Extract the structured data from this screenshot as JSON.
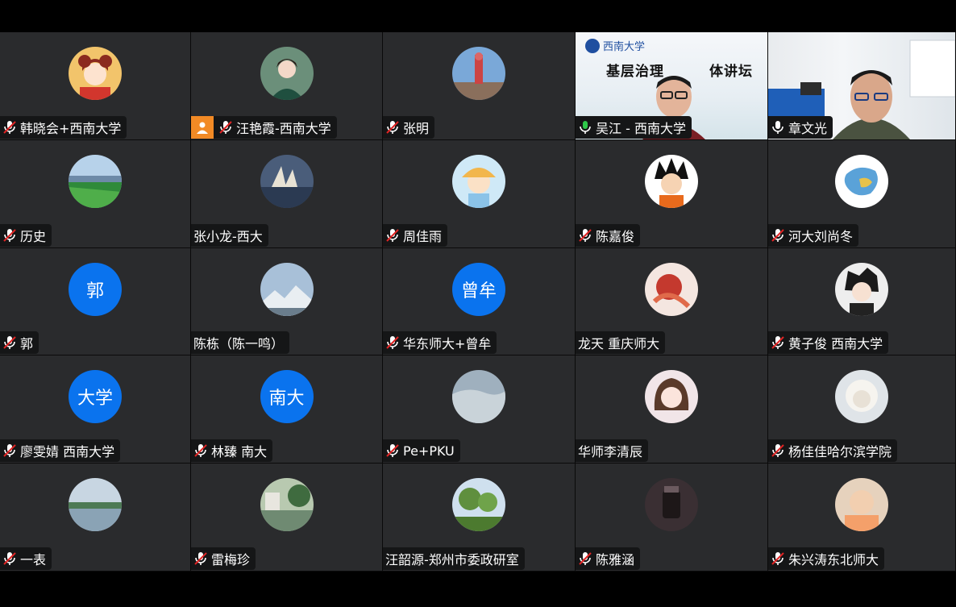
{
  "participants": [
    {
      "name": "韩晓会+西南大学",
      "muted": true,
      "avatar": "illustration-girl"
    },
    {
      "name": "汪艳霞-西南大学",
      "muted": true,
      "avatar": "portrait-woman",
      "host_badge": true
    },
    {
      "name": "张明",
      "muted": true,
      "avatar": "tower-photo"
    },
    {
      "name": "吴江 - 西南大学",
      "muted": false,
      "avatar": "video-slide",
      "speaking": true
    },
    {
      "name": "章文光",
      "muted": false,
      "avatar": "video-room"
    },
    {
      "name": "历史",
      "muted": true,
      "avatar": "lake-photo"
    },
    {
      "name": "张小龙-西大",
      "muted": false,
      "avatar": "opera-house"
    },
    {
      "name": "周佳雨",
      "muted": true,
      "avatar": "cartoon-boy"
    },
    {
      "name": "陈嘉俊",
      "muted": true,
      "avatar": "goku"
    },
    {
      "name": "河大刘尚冬",
      "muted": true,
      "avatar": "china-map"
    },
    {
      "name": "郭",
      "muted": true,
      "avatar": "letter",
      "letter": "郭"
    },
    {
      "name": "陈栋（陈一鸣）",
      "muted": false,
      "avatar": "mountain"
    },
    {
      "name": "华东师大+曾牟",
      "muted": true,
      "avatar": "letter",
      "letter": "曾牟"
    },
    {
      "name": "龙天 重庆师大",
      "muted": false,
      "avatar": "red-art"
    },
    {
      "name": "黄子俊 西南大学",
      "muted": true,
      "avatar": "anime-boy"
    },
    {
      "name": "廖雯婧 西南大学",
      "muted": true,
      "avatar": "letter",
      "letter": "大学"
    },
    {
      "name": "林臻 南大",
      "muted": true,
      "avatar": "letter",
      "letter": "南大"
    },
    {
      "name": "Pe+PKU",
      "muted": true,
      "avatar": "sky"
    },
    {
      "name": "华师李清辰",
      "muted": false,
      "avatar": "anime-girl"
    },
    {
      "name": "杨佳佳哈尔滨学院",
      "muted": true,
      "avatar": "white-lion"
    },
    {
      "name": "一表",
      "muted": true,
      "avatar": "river"
    },
    {
      "name": "雷梅珍",
      "muted": true,
      "avatar": "canal"
    },
    {
      "name": "汪韶源-郑州市委政研室",
      "muted": false,
      "avatar": "trees"
    },
    {
      "name": "陈雅涵",
      "muted": true,
      "avatar": "dark-object"
    },
    {
      "name": "朱兴涛东北师大",
      "muted": true,
      "avatar": "baby"
    }
  ],
  "slide": {
    "title": "基层治理",
    "title_tail": "体讲坛",
    "logo_text": "西南大学"
  },
  "colors": {
    "tile": "#2a2b2d",
    "label_bg": "#151617",
    "letter_avatar": "#0a73ee",
    "host_badge": "#f28a25",
    "mic_muted": "#e02424",
    "mic_active": "#2ec84a"
  }
}
